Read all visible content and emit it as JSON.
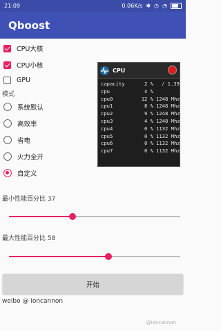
{
  "status_bar": {
    "time": "21:09",
    "network_speed": "0.06K/s"
  },
  "app_bar": {
    "title": "Qboost"
  },
  "cores": [
    {
      "label": "CPU大核",
      "checked": true
    },
    {
      "label": "CPU小核",
      "checked": true
    },
    {
      "label": "GPU",
      "checked": false
    }
  ],
  "mode": {
    "label": "模式",
    "options": [
      {
        "label": "系统默认",
        "selected": false
      },
      {
        "label": "高效率",
        "selected": false
      },
      {
        "label": "省电",
        "selected": false
      },
      {
        "label": "火力全开",
        "selected": false
      },
      {
        "label": "自定义",
        "selected": true
      }
    ]
  },
  "sliders": {
    "min_label": "最小性能百分比 37",
    "min_value": 37,
    "max_label": "最大性能百分比 58",
    "max_value": 58
  },
  "start_button": {
    "label": "开始"
  },
  "footer": {
    "text": "weibo @ ioncannon",
    "watermark": "@ioncannon"
  },
  "overlay": {
    "title": "CPU",
    "rows": [
      {
        "name": "capacity",
        "value": "2 %",
        "extra": "/ 1.39"
      },
      {
        "name": "cpu",
        "value": "4 %",
        "extra": ""
      },
      {
        "name": "cpu0",
        "value": "12 %",
        "extra": "1248 Mhz"
      },
      {
        "name": "cpu1",
        "value": "8 %",
        "extra": "1248 Mhz"
      },
      {
        "name": "cpu2",
        "value": "9 %",
        "extra": "1248 Mhz"
      },
      {
        "name": "cpu3",
        "value": "4 %",
        "extra": "1248 Mhz"
      },
      {
        "name": "cpu4",
        "value": "0 %",
        "extra": "1132 Mhz"
      },
      {
        "name": "cpu5",
        "value": "0 %",
        "extra": "1132 Mhz"
      },
      {
        "name": "cpu6",
        "value": "0 %",
        "extra": "1132 Mhz"
      },
      {
        "name": "cpu7",
        "value": "0 %",
        "extra": "1132 Mhz"
      }
    ]
  },
  "colors": {
    "primary": "#3f51b5",
    "primary_dark": "#3a4ca8",
    "accent": "#e91e63",
    "overlay_bg": "#1e1e1e",
    "close": "#e01919"
  }
}
